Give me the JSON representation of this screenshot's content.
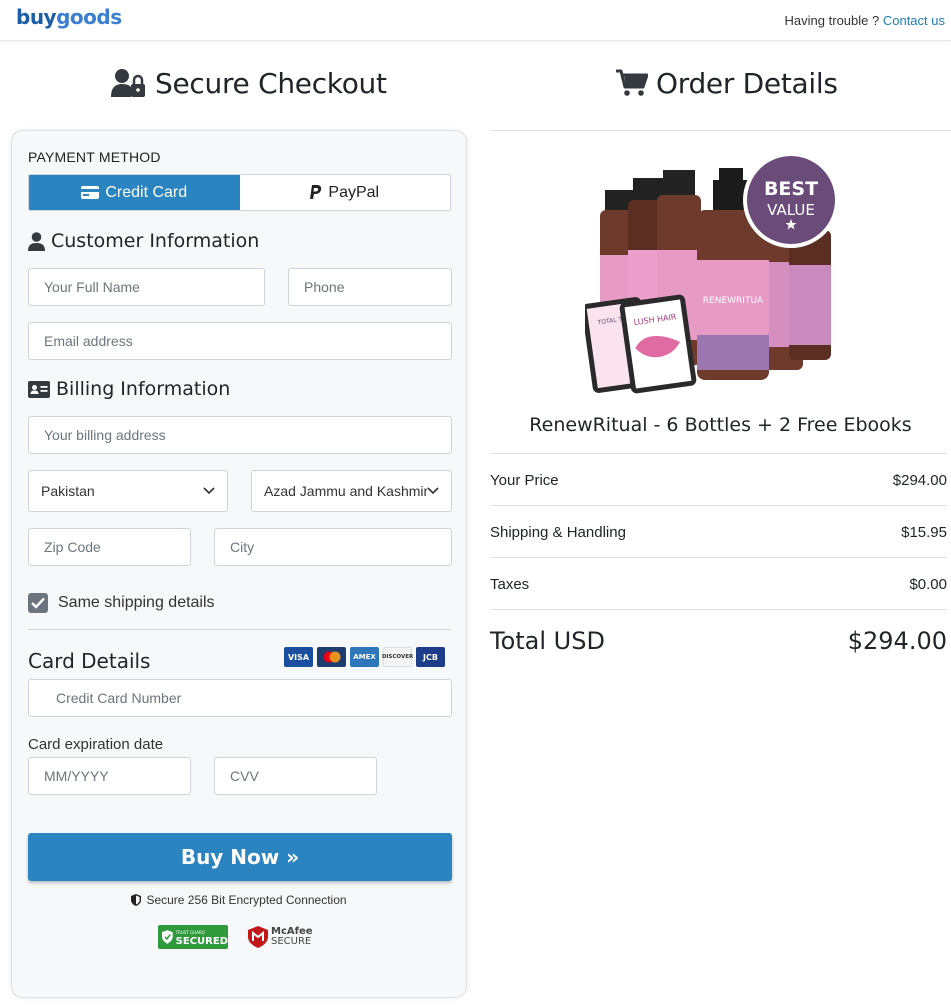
{
  "header": {
    "logo_part1": "buy",
    "logo_part2": "goods",
    "trouble_text": "Having trouble ?",
    "contact_link": "Contact us"
  },
  "checkout": {
    "title": "Secure Checkout",
    "payment_method_label": "PAYMENT METHOD",
    "tabs": [
      {
        "label": "Credit Card",
        "icon": "credit-card-icon",
        "active": true
      },
      {
        "label": "PayPal",
        "icon": "paypal-icon",
        "active": false
      }
    ],
    "customer_title": "Customer Information",
    "full_name_placeholder": "Your Full Name",
    "phone_placeholder": "Phone",
    "email_placeholder": "Email address",
    "billing_title": "Billing Information",
    "billing_address_placeholder": "Your billing address",
    "country_value": "Pakistan",
    "region_value": "Azad Jammu and Kashmir",
    "zip_placeholder": "Zip Code",
    "city_placeholder": "City",
    "same_shipping_label": "Same shipping details",
    "same_shipping_checked": true,
    "card_details_title": "Card Details",
    "card_logos": [
      "VISA",
      "MC",
      "AMEX",
      "DISCOVER",
      "JCB"
    ],
    "card_number_placeholder": "Credit Card Number",
    "expiration_label": "Card expiration date",
    "expiry_placeholder": "MM/YYYY",
    "cvv_placeholder": "CVV",
    "buy_button": "Buy Now »",
    "secure_text": "Secure 256 Bit Encrypted Connection",
    "badge_trust_small": "TRUST GUARD",
    "badge_secured": "SECURED",
    "badge_mcafee_line1": "McAfee",
    "badge_mcafee_line2": "SECURE"
  },
  "order": {
    "title": "Order Details",
    "badge_line1": "BEST",
    "badge_line2": "VALUE",
    "product_name": "RenewRitual - 6 Bottles + 2 Free Ebooks",
    "ebook1": "TOTAL TRANSFO",
    "ebook2": "LUSH HAIR",
    "bottle_label": "RENEWRITUA",
    "rows": [
      {
        "label": "Your Price",
        "value": "$294.00"
      },
      {
        "label": "Shipping & Handling",
        "value": "$15.95"
      },
      {
        "label": "Taxes",
        "value": "$0.00"
      }
    ],
    "total_label": "Total USD",
    "total_value": "$294.00"
  },
  "colors": {
    "primary": "#2a84bf",
    "badge_purple": "#6b4b7a",
    "bottle_pink": "#e79ac4",
    "bottle_amber": "#6e3a2c"
  }
}
